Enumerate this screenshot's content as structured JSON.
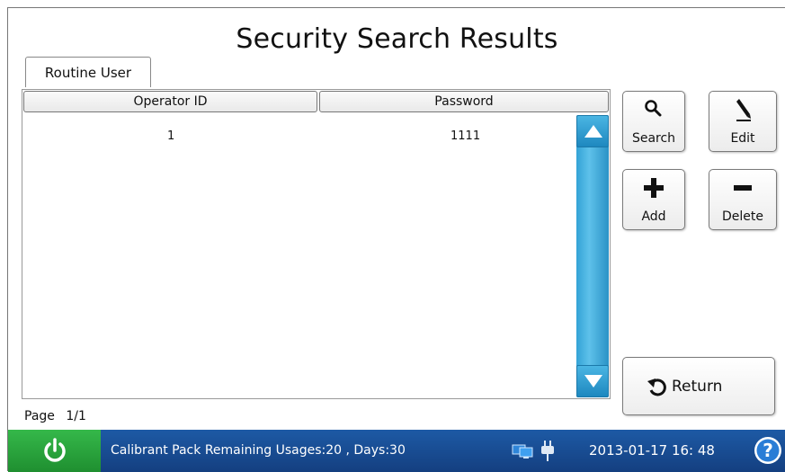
{
  "page": {
    "title": "Security Search Results"
  },
  "tabs": [
    {
      "label": "Routine User",
      "active": true
    }
  ],
  "table": {
    "columns": [
      "Operator ID",
      "Password"
    ],
    "rows": [
      {
        "operator_id": "1",
        "password": "1111"
      }
    ]
  },
  "actions": {
    "search_label": "Search",
    "edit_label": "Edit",
    "add_label": "Add",
    "delete_label": "Delete",
    "return_label": "Return"
  },
  "pagination": {
    "label": "Page",
    "value": "1/1"
  },
  "statusbar": {
    "message": "Calibrant Pack Remaining Usages:20 , Days:30",
    "datetime": "2013-01-17  16: 48",
    "power_color": "#2aa53e",
    "bar_color": "#1a4f96"
  },
  "icons": {
    "search": "magnifier-icon",
    "edit": "pencil-icon",
    "add": "plus-icon",
    "delete": "minus-icon",
    "return": "return-arrow-icon",
    "power": "power-icon",
    "network": "network-computers-icon",
    "plug": "power-plug-icon",
    "help": "help-icon"
  }
}
